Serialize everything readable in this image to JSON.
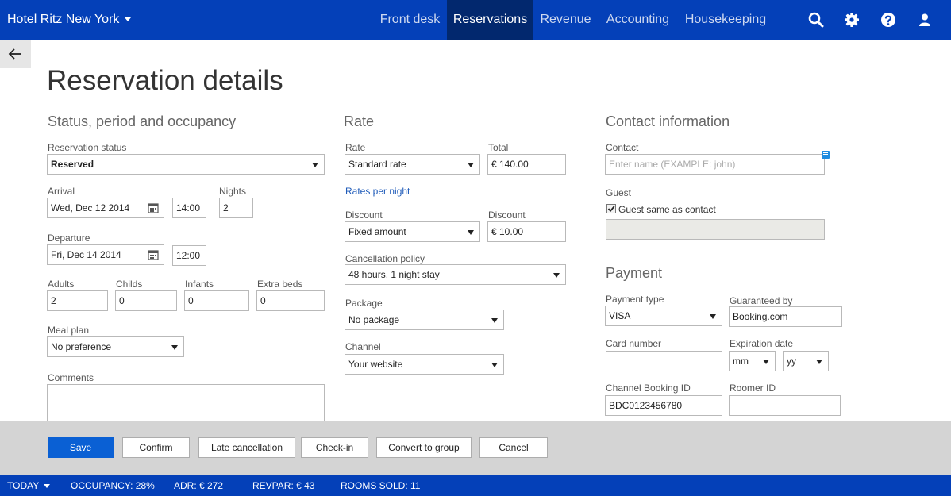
{
  "topbar": {
    "hotel": "Hotel Ritz New York",
    "nav": [
      {
        "label": "Front desk"
      },
      {
        "label": "Reservations"
      },
      {
        "label": "Revenue"
      },
      {
        "label": "Accounting"
      },
      {
        "label": "Housekeeping"
      }
    ],
    "active_nav": "Reservations",
    "icons": [
      "search-icon",
      "gear-icon",
      "help-icon",
      "user-icon"
    ]
  },
  "page": {
    "title": "Reservation details"
  },
  "status_section": {
    "heading": "Status, period and occupancy",
    "reservation_status_label": "Reservation status",
    "reservation_status": "Reserved",
    "arrival_label": "Arrival",
    "arrival_date": "Wed, Dec 12 2014",
    "arrival_time": "14:00",
    "nights_label": "Nights",
    "nights": "2",
    "departure_label": "Departure",
    "departure_date": "Fri, Dec 14 2014",
    "departure_time": "12:00",
    "adults_label": "Adults",
    "adults": "2",
    "childs_label": "Childs",
    "childs": "0",
    "infants_label": "Infants",
    "infants": "0",
    "extra_beds_label": "Extra beds",
    "extra_beds": "0",
    "meal_plan_label": "Meal plan",
    "meal_plan": "No preference",
    "comments_label": "Comments",
    "comments": ""
  },
  "rate_section": {
    "heading": "Rate",
    "rate_label": "Rate",
    "rate": "Standard rate",
    "total_label": "Total",
    "total": "€ 140.00",
    "rates_per_night": "Rates per night",
    "discount_type_label": "Discount",
    "discount_type": "Fixed amount",
    "discount_label": "Discount",
    "discount": "€ 10.00",
    "cancellation_label": "Cancellation policy",
    "cancellation": "48 hours, 1 night stay",
    "package_label": "Package",
    "package": "No package",
    "channel_label": "Channel",
    "channel": "Your website"
  },
  "contact_section": {
    "heading": "Contact information",
    "contact_label": "Contact",
    "contact_placeholder": "Enter name (EXAMPLE: john)",
    "guest_label": "Guest",
    "guest_same_label": "Guest same as contact",
    "guest_same_checked": true
  },
  "payment_section": {
    "heading": "Payment",
    "payment_type_label": "Payment type",
    "payment_type": "VISA",
    "guaranteed_label": "Guaranteed by",
    "guaranteed": "Booking.com",
    "card_label": "Card number",
    "card": "",
    "expiration_label": "Expiration date",
    "exp_month": "mm",
    "exp_year": "yy",
    "channel_booking_label": "Channel Booking ID",
    "channel_booking": "BDC0123456780",
    "roomer_label": "Roomer ID",
    "roomer": ""
  },
  "actions": {
    "save": "Save",
    "confirm": "Confirm",
    "late_cancel": "Late cancellation",
    "checkin": "Check-in",
    "convert": "Convert to group",
    "cancel": "Cancel"
  },
  "statusbar": {
    "today": "TODAY",
    "occupancy": "OCCUPANCY: 28%",
    "adr": "ADR: € 272",
    "revpar": "REVPAR: € 43",
    "rooms_sold": "ROOMS SOLD: 11"
  },
  "colors": {
    "brand": "#0440b8",
    "active_nav": "#02286e",
    "primary_button": "#0a60d4"
  }
}
